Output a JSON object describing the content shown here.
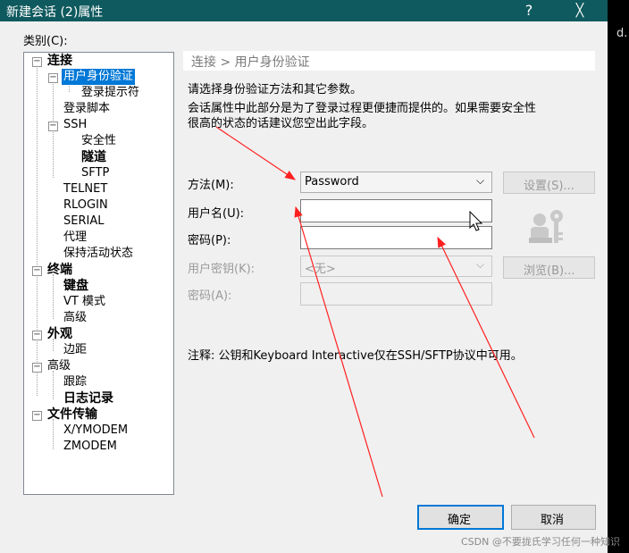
{
  "window": {
    "title": "新建会话 (2)属性",
    "help_glyph": "?",
    "close_glyph": "╳"
  },
  "background": {
    "stray_glyph": "d."
  },
  "category_label": "类别(C):",
  "tree": {
    "connection": "连接",
    "auth": "用户身份验证",
    "login_prompt": "登录提示符",
    "login_script": "登录脚本",
    "ssh": "SSH",
    "security": "安全性",
    "tunnel": "隧道",
    "sftp": "SFTP",
    "telnet": "TELNET",
    "rlogin": "RLOGIN",
    "serial": "SERIAL",
    "proxy": "代理",
    "keepalive": "保持活动状态",
    "terminal": "终端",
    "keyboard": "键盘",
    "vt_mode": "VT 模式",
    "advanced_term": "高级",
    "appearance": "外观",
    "margins": "边距",
    "advanced": "高级",
    "trace": "跟踪",
    "logging": "日志记录",
    "file_transfer": "文件传输",
    "xymodem": "X/YMODEM",
    "zmodem": "ZMODEM"
  },
  "main": {
    "header": "连接 > 用户身份验证",
    "intro": "请选择身份验证方法和其它参数。",
    "desc_line1": "会话属性中此部分是为了登录过程更便捷而提供的。如果需要安全性",
    "desc_line2": "很高的状态的话建议您空出此字段。",
    "method_label": "方法(M):",
    "method_value": "Password",
    "settings_button": "设置(S)...",
    "username_label": "用户名(U):",
    "username_value": "",
    "password_label": "密码(P):",
    "password_value": "",
    "userkey_label": "用户密钥(K):",
    "userkey_value": "<无>",
    "browse_button": "浏览(B)...",
    "passphrase_label": "密码(A):",
    "note": "注释: 公钥和Keyboard Interactive仅在SSH/SFTP协议中可用。"
  },
  "buttons": {
    "ok": "确定",
    "cancel": "取消"
  },
  "watermark": "CSDN @不要拢氏学习任何一种知识",
  "colors": {
    "titlebar": "#0f5a5e",
    "selection": "#0078d7",
    "annotation_arrow": "#ff2020"
  }
}
